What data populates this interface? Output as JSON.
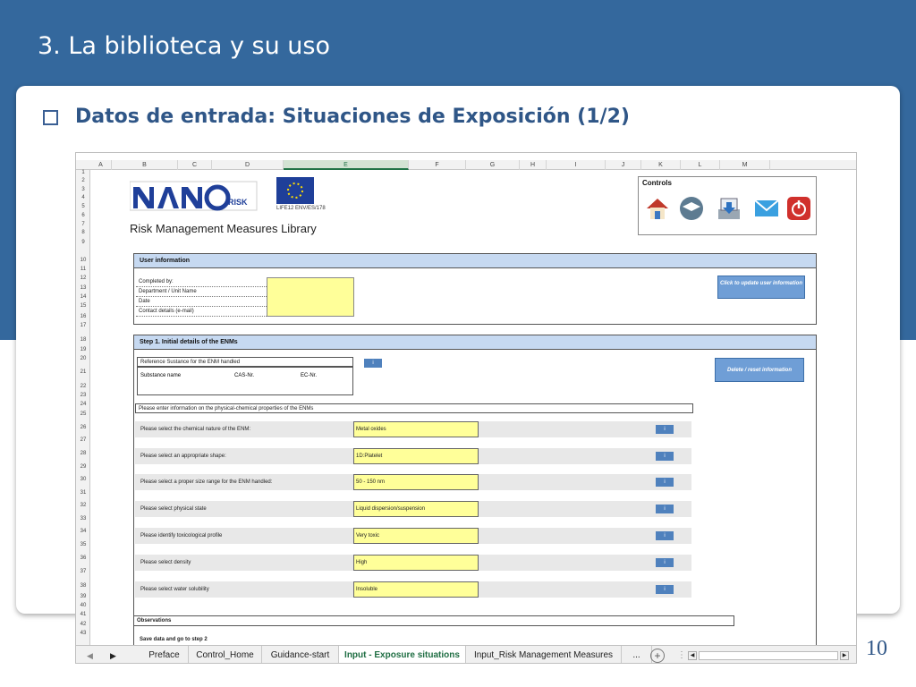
{
  "slide": {
    "title": "3. La biblioteca y su uso",
    "subtitle": "Datos de entrada: Situaciones de Exposición (1/2)",
    "page_number": "10"
  },
  "sheet": {
    "columns": [
      "A",
      "B",
      "C",
      "D",
      "E",
      "F",
      "G",
      "H",
      "I",
      "J",
      "K",
      "L",
      "M"
    ],
    "selected_column": "E",
    "rows": [
      "1",
      "2",
      "3",
      "4",
      "5",
      "6",
      "7",
      "8",
      "9",
      "10",
      "11",
      "12",
      "13",
      "14",
      "15",
      "16",
      "17",
      "18",
      "19",
      "20",
      "21",
      "22",
      "23",
      "24",
      "25",
      "26",
      "27",
      "28",
      "29",
      "30",
      "31",
      "32",
      "33",
      "34",
      "35",
      "36",
      "37",
      "38",
      "39",
      "40",
      "41",
      "42",
      "43"
    ],
    "logo": {
      "text": "NANO",
      "suffix": "RISK",
      "life_code": "LIFE12 ENV/ES/178"
    },
    "library_title": "Risk Management Measures Library",
    "controls": {
      "label": "Controls",
      "icons": [
        "home-icon",
        "tutorial-icon",
        "download-icon",
        "mail-icon",
        "power-icon"
      ]
    },
    "user_info": {
      "header": "User information",
      "fields": [
        "Completed by:",
        "Department / Unit Name",
        "Date",
        "Contact details (e-mail)"
      ],
      "update_button": "Click to update user information"
    },
    "step1": {
      "header": "Step 1.  Initial details of the ENMs",
      "ref_label": "Reference Sustance for the ENM handled",
      "info_button": "i",
      "substance_cols": [
        "Substance name",
        "CAS-Nr.",
        "EC-Nr."
      ],
      "delete_button": "Delete / reset information",
      "intro": "Please enter information on the physical-chemical properties of the ENMs",
      "questions": [
        {
          "label": "Please select the chemical nature of the ENM:",
          "value": "Metal oxides"
        },
        {
          "label": "Please select an appropriate shape:",
          "value": "1D:Platelet"
        },
        {
          "label": "Please select a proper size range for the ENM handled:",
          "value": "50 - 150 nm"
        },
        {
          "label": "Please select physical state",
          "value": "Liquid dispersion/suspension"
        },
        {
          "label": "Please identify toxicological profile",
          "value": "Very toxic"
        },
        {
          "label": "Please select density",
          "value": "High"
        },
        {
          "label": "Please select water solubility",
          "value": "Insoluble"
        }
      ]
    },
    "observations": "Observations",
    "save_step": "Save data and go to step 2",
    "tabs": [
      "Preface",
      "Control_Home",
      "Guidance-start",
      "Input - Exposure situations",
      "Input_Risk Management Measures",
      "..."
    ],
    "active_tab": "Input - Exposure situations"
  },
  "colors": {
    "band": "#34689d",
    "header_fill": "#c6d9f1",
    "input_fill": "#ffff99",
    "button_fill": "#6f9ed6",
    "excel_green": "#217346"
  }
}
